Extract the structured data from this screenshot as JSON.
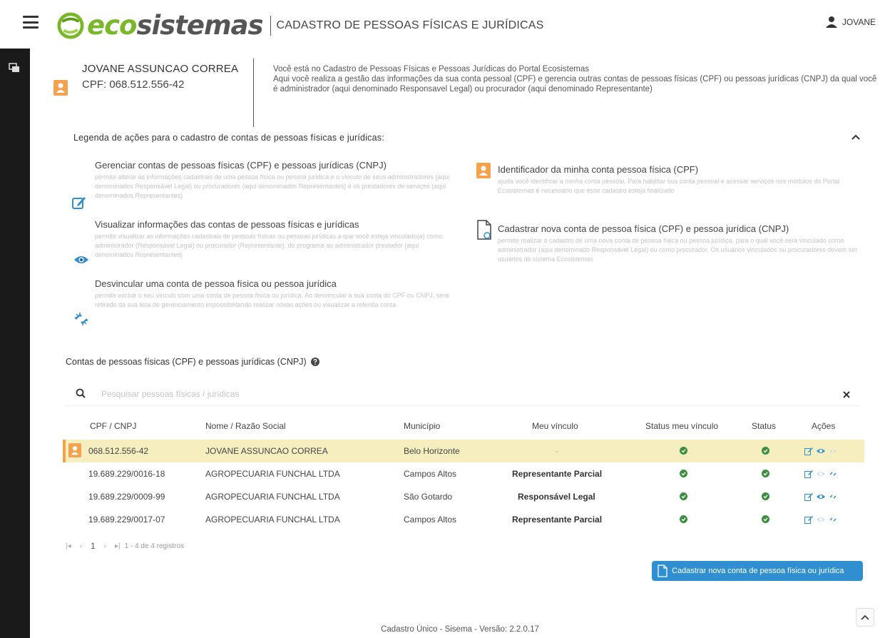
{
  "header": {
    "logo_eco": "eco",
    "logo_sis": "sistemas",
    "app_title": "CADASTRO DE PESSOAS FÍSICAS E JURÍDICAS",
    "user_name": "JOVANE"
  },
  "profile": {
    "name": "JOVANE ASSUNCAO CORREA",
    "cpf": "CPF: 068.512.556-42"
  },
  "intro": {
    "line1": "Você está no Cadastro de Pessoas Físicas e Pessoas Jurídicas do Portal Ecosistemas",
    "line2": "Aqui você realiza a gestão das informações da sua conta pessoal (CPF) e gerencia outras contas de pessoas físicas (CPF) ou pessoas jurídicas (CNPJ) da qual você é administrador (aqui denominado Responsavel Legal) ou procurador (aqui denominado Representante)"
  },
  "legend": {
    "title": "Legenda de ações para o cadastro de contas de pessoas físicas e jurídicas:",
    "items": [
      {
        "title": "Gerenciar contas de pessoas físicas (CPF) e pessoas jurídicas (CNPJ)",
        "desc": "permite alterar as informações cadastrais de uma pessoa física ou pessoa jurídica e o vínculo de seus administradores (aqui denominados Responsável Legal) ou procuradores (aqui denominados Representantes) e os prestadores de serviços (aqui denominados Representantes)"
      },
      {
        "title": "Identificador da minha conta pessoa física (CPF)",
        "desc": "ajuda você identificar a minha conta pessoal. Para habilitar sua conta pessoal e acessar serviços nos módulos do Portal Ecosistemas é necessário que esse cadastro esteja finalizado"
      },
      {
        "title": "Visualizar informações das contas de pessoas físicas e jurídicas",
        "desc": "permite visualizar as informações cadastrais de pessoas físicas ou pessoas jurídicas a que você esteja vinculado(a) como administrador (Responsável Legal) ou procurador (Representante), do programa ao administrador prestador (aqui denominados Representantes)"
      },
      {
        "title": "Cadastrar nova conta de pessoa física (CPF) e pessoa jurídica (CNPJ)",
        "desc": "permite realizar o cadastro de uma nova conta de pessoa física ou pessoa jurídica, para o qual você será vinculado como administrador (aqui denominado Responsável Legal) ou como procurador. Os usuários vinculados ou procuradores devem ser usuários do sistema Ecosistemas"
      },
      {
        "title": "Desvincular uma conta de pessoa física ou pessoa jurídica",
        "desc": "permite excluir o seu vínculo com uma conta de pessoa física ou jurídica. Ao desvincular a sua conta do CPF ou CNPJ, será retirado da sua lista de gerenciamento impossibilitando realizar novas ações ou visualizar a referida conta"
      }
    ]
  },
  "accounts": {
    "title": "Contas de pessoas físicas (CPF) e pessoas jurídicas (CNPJ)",
    "search_placeholder": "Pesquisar pessoas físicas / jurídicas",
    "columns": [
      "CPF / CNPJ",
      "Nome / Razão Social",
      "Município",
      "Meu vínculo",
      "Status meu vínculo",
      "Status",
      "Ações"
    ],
    "rows": [
      {
        "doc": "068.512.556-42",
        "name": "JOVANE ASSUNCAO CORREA",
        "city": "Belo Horizonte",
        "link": "-"
      },
      {
        "doc": "19.689.229/0016-18",
        "name": "AGROPECUARIA FUNCHAL LTDA",
        "city": "Campos Altos",
        "link": "Representante Parcial"
      },
      {
        "doc": "19.689.229/0009-99",
        "name": "AGROPECUARIA FUNCHAL LTDA",
        "city": "São Gotardo",
        "link": "Responsável Legal"
      },
      {
        "doc": "19.689.229/0017-07",
        "name": "AGROPECUARIA FUNCHAL LTDA",
        "city": "Campos Altos",
        "link": "Representante Parcial"
      }
    ]
  },
  "pagination": {
    "current_page": "1",
    "summary": "1 - 4 de 4 registros"
  },
  "new_account_button": "Cadastrar nova conta de pessoa física ou jurídica",
  "footer": "Cadastro Único - Sisema - Versão: 2.2.0.17",
  "colors": {
    "brand_green": "#7ab829",
    "accent_orange": "#f4a34c",
    "highlight_row": "#f7eec0",
    "status_green": "#3e8e41",
    "action_blue": "#2f8fd0"
  },
  "icons": [
    "menu-icon",
    "user-icon",
    "window-icon",
    "badge-icon",
    "chevron-up-icon",
    "edit-icon",
    "eye-icon",
    "document-icon",
    "unlink-icon",
    "search-icon",
    "close-icon",
    "question-icon",
    "check-circle-icon"
  ]
}
